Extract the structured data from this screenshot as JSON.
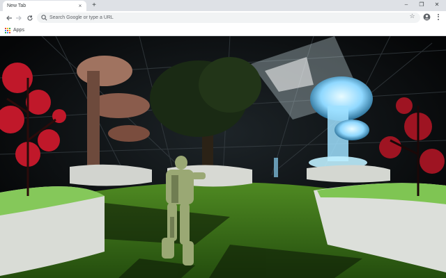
{
  "tab": {
    "title": "New Tab",
    "close_glyph": "×"
  },
  "new_tab_glyph": "+",
  "window_controls": {
    "minimize": "–",
    "restore": "❐",
    "close": "✕"
  },
  "omnibox": {
    "placeholder": "Search Google or type a URL"
  },
  "bookmarks": {
    "apps_label": "Apps"
  },
  "icons": {
    "back": "back-arrow-icon",
    "forward": "forward-arrow-icon",
    "reload": "reload-icon",
    "search": "google-search-icon",
    "star": "bookmark-star-icon",
    "profile": "profile-icon",
    "menu": "kebab-menu-icon",
    "apps": "apps-grid-icon"
  },
  "colors": {
    "tabstrip": "#dee1e6",
    "toolbar": "#ffffff",
    "omnibox": "#f1f3f4",
    "grass": "#3f7a1d",
    "red_foliage": "#c0182a",
    "hologram": "#8fd8ff"
  },
  "star_glyph": "☆"
}
